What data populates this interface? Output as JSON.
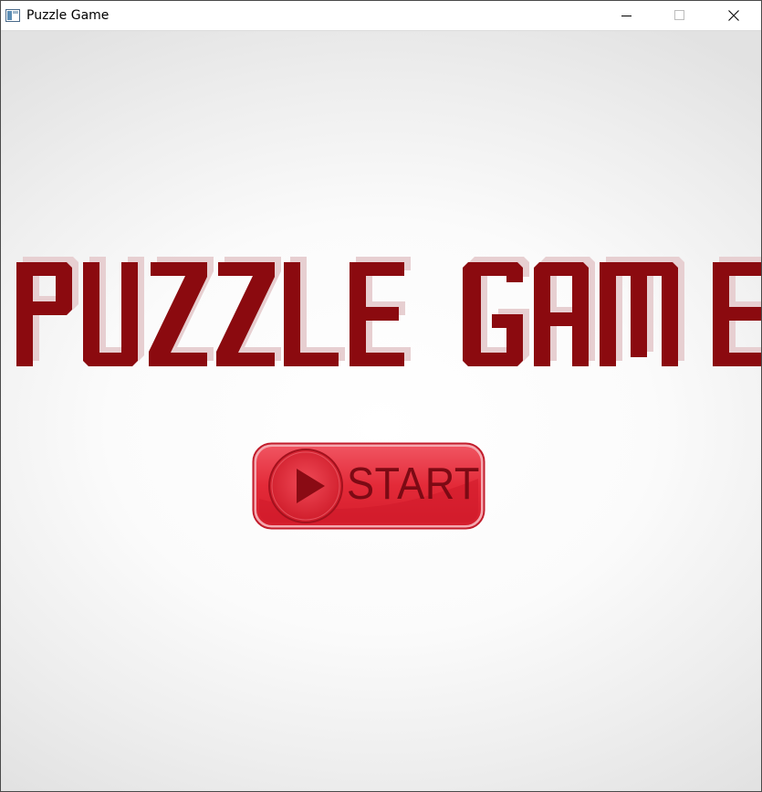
{
  "window": {
    "title": "Puzzle Game",
    "controls": [
      "minimize",
      "maximize",
      "close"
    ]
  },
  "game": {
    "title": "PUZZLE GAME",
    "start_label": "START"
  },
  "colors": {
    "title_red": "#8b0a0f",
    "title_shadow": "#e4c6c8",
    "button_red": "#e42735",
    "button_border": "#b81a28",
    "play_dark": "#8a0b14"
  },
  "icons": {
    "app": "window-app-icon",
    "play": "play-icon"
  }
}
